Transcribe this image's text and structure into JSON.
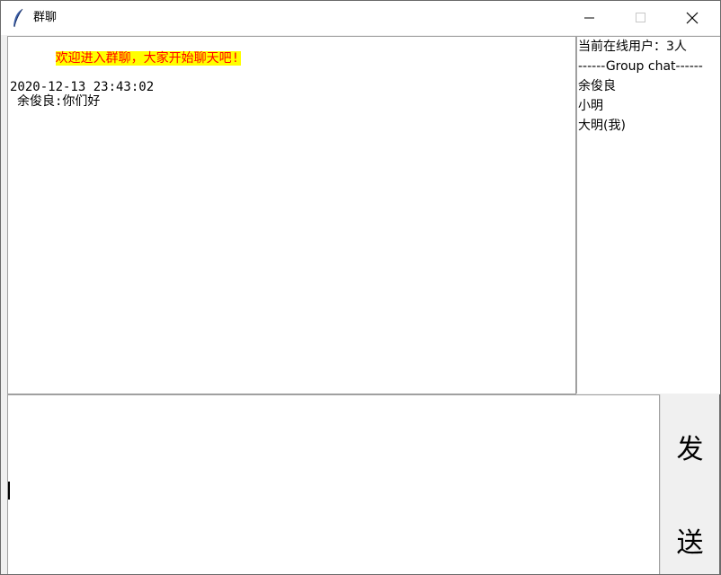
{
  "window": {
    "title": "群聊",
    "icon": "feather-icon"
  },
  "chat": {
    "welcome": "欢迎进入群聊，大家开始聊天吧!",
    "messages": [
      {
        "timestamp": "2020-12-13 23:43:02",
        "text": "余俊良:你们好"
      }
    ]
  },
  "users": {
    "count_label": "当前在线用户：3人",
    "separator": "------Group chat------",
    "list": [
      "余俊良",
      "小明",
      "大明(我)"
    ]
  },
  "input": {
    "value": ""
  },
  "send_button": {
    "char1": "发",
    "char2": "送"
  },
  "colors": {
    "welcome_fg": "#ff0000",
    "welcome_bg": "#ffff00"
  }
}
